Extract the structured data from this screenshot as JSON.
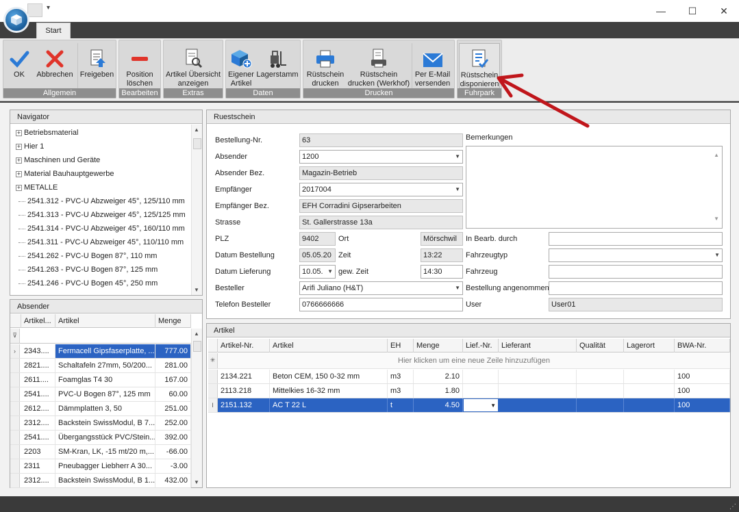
{
  "window": {
    "minimize": "—",
    "maximize": "☐",
    "close": "✕",
    "qat_arrow": "▾"
  },
  "tabs": [
    {
      "label": "Start"
    }
  ],
  "ribbon": {
    "groups": [
      {
        "label": "Allgemein",
        "buttons": [
          {
            "label": "OK",
            "icon": "check-icon"
          },
          {
            "label": "Abbrechen",
            "icon": "cross-icon"
          },
          {
            "label": "Freigeben",
            "icon": "release-document-icon"
          }
        ]
      },
      {
        "label": "Bearbeiten",
        "buttons": [
          {
            "label": "Position löschen",
            "icon": "minus-icon"
          }
        ]
      },
      {
        "label": "Extras",
        "buttons": [
          {
            "label": "Artikel Übersicht anzeigen",
            "icon": "document-search-icon"
          }
        ]
      },
      {
        "label": "Daten",
        "buttons": [
          {
            "label": "Eigener Artikel",
            "icon": "cube-add-icon"
          },
          {
            "label": "Lagerstamm",
            "icon": "forklift-icon"
          }
        ]
      },
      {
        "label": "Drucken",
        "buttons": [
          {
            "label": "Rüstschein drucken",
            "icon": "printer-icon"
          },
          {
            "label": "Rüstschein drucken (Werkhof)",
            "icon": "print-document-icon"
          },
          {
            "label": "Per E-Mail versenden",
            "icon": "envelope-icon"
          }
        ]
      },
      {
        "label": "Fuhrpark",
        "buttons": [
          {
            "label": "Rüstschein disponieren",
            "icon": "checklist-icon"
          }
        ]
      }
    ]
  },
  "navigator": {
    "title": "Navigator",
    "items": [
      {
        "label": "Betriebsmaterial",
        "expandable": true
      },
      {
        "label": "Hier 1",
        "expandable": true
      },
      {
        "label": "Maschinen und Geräte",
        "expandable": true
      },
      {
        "label": "Material Bauhauptgewerbe",
        "expandable": true
      },
      {
        "label": "METALLE",
        "expandable": true
      },
      {
        "label": "2541.312 - PVC-U Abzweiger 45°, 125/110 mm",
        "expandable": false
      },
      {
        "label": "2541.313 - PVC-U Abzweiger 45°, 125/125 mm",
        "expandable": false
      },
      {
        "label": "2541.314 - PVC-U Abzweiger 45°, 160/110 mm",
        "expandable": false
      },
      {
        "label": "2541.311 - PVC-U Abzweiger 45°, 110/110 mm",
        "expandable": false
      },
      {
        "label": "2541.262 - PVC-U Bogen 87°, 110 mm",
        "expandable": false
      },
      {
        "label": "2541.263 - PVC-U Bogen 87°, 125 mm",
        "expandable": false
      },
      {
        "label": "2541.246 - PVC-U Bogen 45°, 250 mm",
        "expandable": false
      }
    ]
  },
  "absender": {
    "title": "Absender",
    "columns": [
      "Artikel...",
      "Artikel",
      "Menge"
    ],
    "rows": [
      {
        "nr": "2343....",
        "artikel": "Fermacell Gipsfaserplatte, ...",
        "menge": "777.00",
        "selected": true
      },
      {
        "nr": "2821....",
        "artikel": "Schaltafeln 27mm, 50/200...",
        "menge": "281.00"
      },
      {
        "nr": "2611....",
        "artikel": "Foamglas  T4   30",
        "menge": "167.00"
      },
      {
        "nr": "2541....",
        "artikel": "PVC-U Bogen 87°, 125 mm",
        "menge": "60.00"
      },
      {
        "nr": "2612....",
        "artikel": "Dämmplatten 3, 50",
        "menge": "251.00"
      },
      {
        "nr": "2312....",
        "artikel": "Backstein SwissModul, B 7...",
        "menge": "252.00"
      },
      {
        "nr": "2541....",
        "artikel": "Übergangsstück PVC/Stein...",
        "menge": "392.00"
      },
      {
        "nr": "2203",
        "artikel": "SM-Kran, LK, -15 mt/20 m,...",
        "menge": "-66.00"
      },
      {
        "nr": "2311",
        "artikel": "Pneubagger Liebherr A 30...",
        "menge": "-3.00"
      },
      {
        "nr": "2312....",
        "artikel": "Backstein SwissModul, B 1...",
        "menge": "432.00"
      }
    ]
  },
  "ruestschein": {
    "title": "Ruestschein",
    "labels": {
      "bestellung_nr": "Bestellung-Nr.",
      "absender": "Absender",
      "absender_bez": "Absender Bez.",
      "empfaenger": "Empfänger",
      "empfaenger_bez": "Empfänger Bez.",
      "strasse": "Strasse",
      "plz": "PLZ",
      "ort": "Ort",
      "datum_bestellung": "Datum Bestellung",
      "zeit": "Zeit",
      "datum_lieferung": "Datum Lieferung",
      "gew_zeit": "gew. Zeit",
      "besteller": "Besteller",
      "telefon_besteller": "Telefon Besteller",
      "bemerkungen": "Bemerkungen",
      "in_bearb_durch": "In Bearb. durch",
      "fahrzeugtyp": "Fahrzeugtyp",
      "fahrzeug": "Fahrzeug",
      "bestellung_angenommen": "Bestellung angenommen",
      "user": "User"
    },
    "values": {
      "bestellung_nr": "63",
      "absender": "1200",
      "absender_bez": "Magazin-Betrieb",
      "empfaenger": "2017004",
      "empfaenger_bez": "EFH Corradini Gipserarbeiten",
      "strasse": "St. Gallerstrasse 13a",
      "plz": "9402",
      "ort": "Mörschwil",
      "datum_bestellung": "05.05.20",
      "zeit": "13:22",
      "datum_lieferung": "10.05.",
      "gew_zeit": "14:30",
      "besteller": "Arifi Juliano (H&T)",
      "telefon_besteller": "0766666666",
      "bemerkungen": "",
      "in_bearb_durch": "",
      "fahrzeugtyp": "",
      "fahrzeug": "",
      "bestellung_angenommen": "",
      "user": "User01"
    }
  },
  "artikel": {
    "title": "Artikel",
    "columns": [
      "Artikel-Nr.",
      "Artikel",
      "EH",
      "Menge",
      "Lief.-Nr.",
      "Lieferant",
      "Qualität",
      "Lagerort",
      "BWA-Nr."
    ],
    "new_row_hint": "Hier klicken um eine neue Zeile hinzuzufügen",
    "rows": [
      {
        "nr": "2134.221",
        "artikel": "Beton CEM, 150  0-32 mm",
        "eh": "m3",
        "menge": "2.10",
        "lief_nr": "",
        "lieferant": "",
        "qualitaet": "",
        "lagerort": "",
        "bwa": "100"
      },
      {
        "nr": "2113.218",
        "artikel": "Mittelkies 16-32 mm",
        "eh": "m3",
        "menge": "1.80",
        "lief_nr": "",
        "lieferant": "",
        "qualitaet": "",
        "lagerort": "",
        "bwa": "100"
      },
      {
        "nr": "2151.132",
        "artikel": "AC T 22 L",
        "eh": "t",
        "menge": "4.50",
        "lief_nr": "",
        "lieferant": "",
        "qualitaet": "",
        "lagerort": "",
        "bwa": "100",
        "selected": true
      }
    ]
  },
  "colors": {
    "accent": "#2b63c2",
    "annotation_arrow": "#c0161b",
    "group_label_bg": "#8e8e8e"
  }
}
